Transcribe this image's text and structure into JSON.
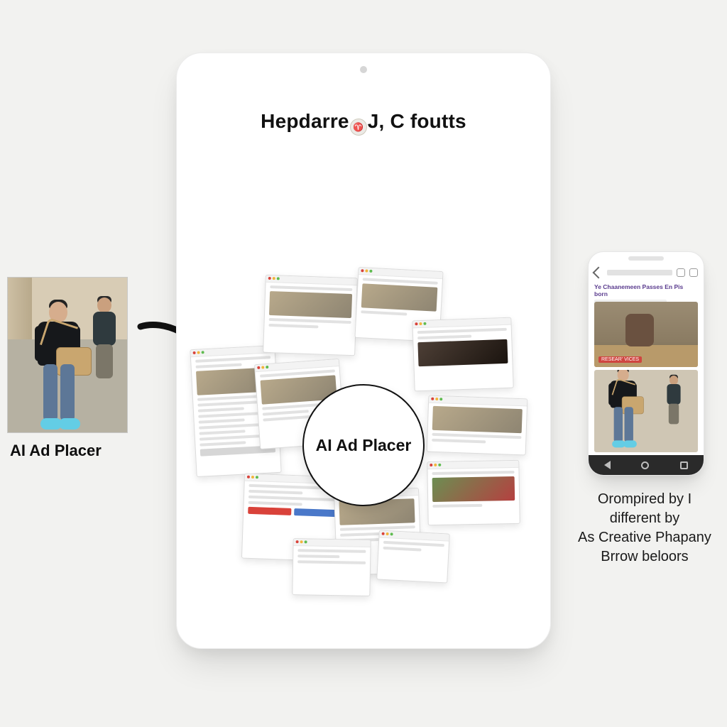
{
  "input": {
    "caption": "AI Ad Placer",
    "subject": "man-walking-with-bag"
  },
  "arrow": {
    "direction": "right-curved"
  },
  "tablet": {
    "title_left": "Hepdarre",
    "title_badge_glyph": "♈",
    "title_right": "J, C foutts",
    "center_badge": "AI Ad Placer",
    "collage_count": 12
  },
  "phone": {
    "header_line": "Ye Chaanemeen Passes En Pis born",
    "top_image_tag": "RESEAR' VICES",
    "nav_icons": [
      "back-triangle",
      "home-circle",
      "recent-square"
    ]
  },
  "phone_caption": {
    "l1": "Orompired by I",
    "l2": "different by",
    "l3": "As Creative Phapany",
    "l4": "Brrow beloors"
  }
}
